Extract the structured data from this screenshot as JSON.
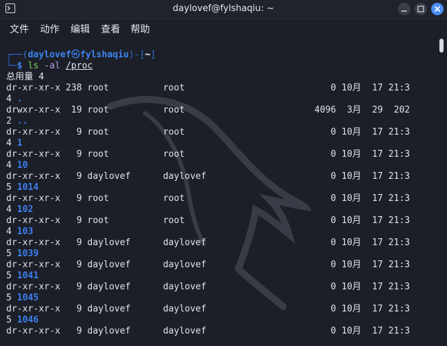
{
  "window": {
    "title": "daylovef@fylshaqiu: ~",
    "controls": [
      "minimize-icon",
      "maximize-icon",
      "close-icon"
    ]
  },
  "menu": [
    "文件",
    "动作",
    "编辑",
    "查看",
    "帮助"
  ],
  "prompt": {
    "frame_top_left": "┌──(",
    "user": "daylovef",
    "skull": "㉿",
    "host": "fylshaqiu",
    "frame_mid": ")-[",
    "dir": "~",
    "frame_top_right": "]",
    "frame_bottom": "└─",
    "dollar": "$",
    "cmd": "ls",
    "flag": "-al",
    "path": "/proc"
  },
  "output": {
    "total_line": "总用量 4",
    "lines": [
      {
        "text": "dr-xr-xr-x 238 root          root                           0 10月  17 21:3"
      },
      {
        "prefix": "4 ",
        "name": "."
      },
      {
        "text": "drwxr-xr-x  19 root          root                        4096  3月  29  202"
      },
      {
        "prefix": "2 ",
        "name": ".."
      },
      {
        "text": "dr-xr-xr-x   9 root          root                           0 10月  17 21:3"
      },
      {
        "prefix": "4 ",
        "name": "1"
      },
      {
        "text": "dr-xr-xr-x   9 root          root                           0 10月  17 21:3"
      },
      {
        "prefix": "4 ",
        "name": "10"
      },
      {
        "text": "dr-xr-xr-x   9 daylovef      daylovef                       0 10月  17 21:3"
      },
      {
        "prefix": "5 ",
        "name": "1014"
      },
      {
        "text": "dr-xr-xr-x   9 root          root                           0 10月  17 21:3"
      },
      {
        "prefix": "4 ",
        "name": "102"
      },
      {
        "text": "dr-xr-xr-x   9 root          root                           0 10月  17 21:3"
      },
      {
        "prefix": "4 ",
        "name": "103"
      },
      {
        "text": "dr-xr-xr-x   9 daylovef      daylovef                       0 10月  17 21:3"
      },
      {
        "prefix": "5 ",
        "name": "1039"
      },
      {
        "text": "dr-xr-xr-x   9 daylovef      daylovef                       0 10月  17 21:3"
      },
      {
        "prefix": "5 ",
        "name": "1041"
      },
      {
        "text": "dr-xr-xr-x   9 daylovef      daylovef                       0 10月  17 21:3"
      },
      {
        "prefix": "5 ",
        "name": "1045"
      },
      {
        "text": "dr-xr-xr-x   9 daylovef      daylovef                       0 10月  17 21:3"
      },
      {
        "prefix": "5 ",
        "name": "1046"
      },
      {
        "text": "dr-xr-xr-x   9 daylovef      daylovef                       0 10月  17 21:3"
      }
    ]
  },
  "colors": {
    "background": "#1c1f27",
    "prompt_frame": "#2f6bd8",
    "prompt_user": "#3c84f0",
    "command": "#7bd45d",
    "directory": "#3c7ff0",
    "close_button": "#4b8ff5"
  }
}
